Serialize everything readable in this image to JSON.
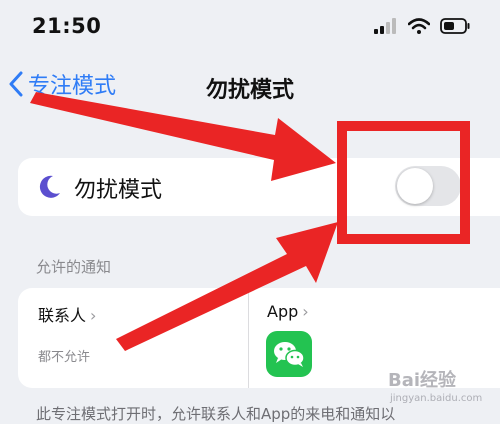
{
  "status_bar": {
    "time": "21:50",
    "icons": [
      "signal-icon",
      "wifi-icon",
      "battery-icon"
    ]
  },
  "nav": {
    "back_label": "专注模式",
    "title": "勿扰模式"
  },
  "dnd_row": {
    "icon": "moon-icon",
    "label": "勿扰模式",
    "toggle_on": false
  },
  "allowed_notifications": {
    "header": "允许的通知",
    "contacts": {
      "label": "联系人",
      "value": "都不允许"
    },
    "apps": {
      "label": "App",
      "icon": "wechat-icon"
    }
  },
  "footer": {
    "text": "此专注模式打开时，允许联系人和App的来电和通知以"
  },
  "annotations": {
    "highlight_color": "#ea2525"
  },
  "watermark": {
    "text": "Bai经验",
    "sub": "jingyan.baidu.com"
  },
  "colors": {
    "accent": "#2f7cf6",
    "moon": "#5b4fcf",
    "wechat": "#23c351"
  }
}
